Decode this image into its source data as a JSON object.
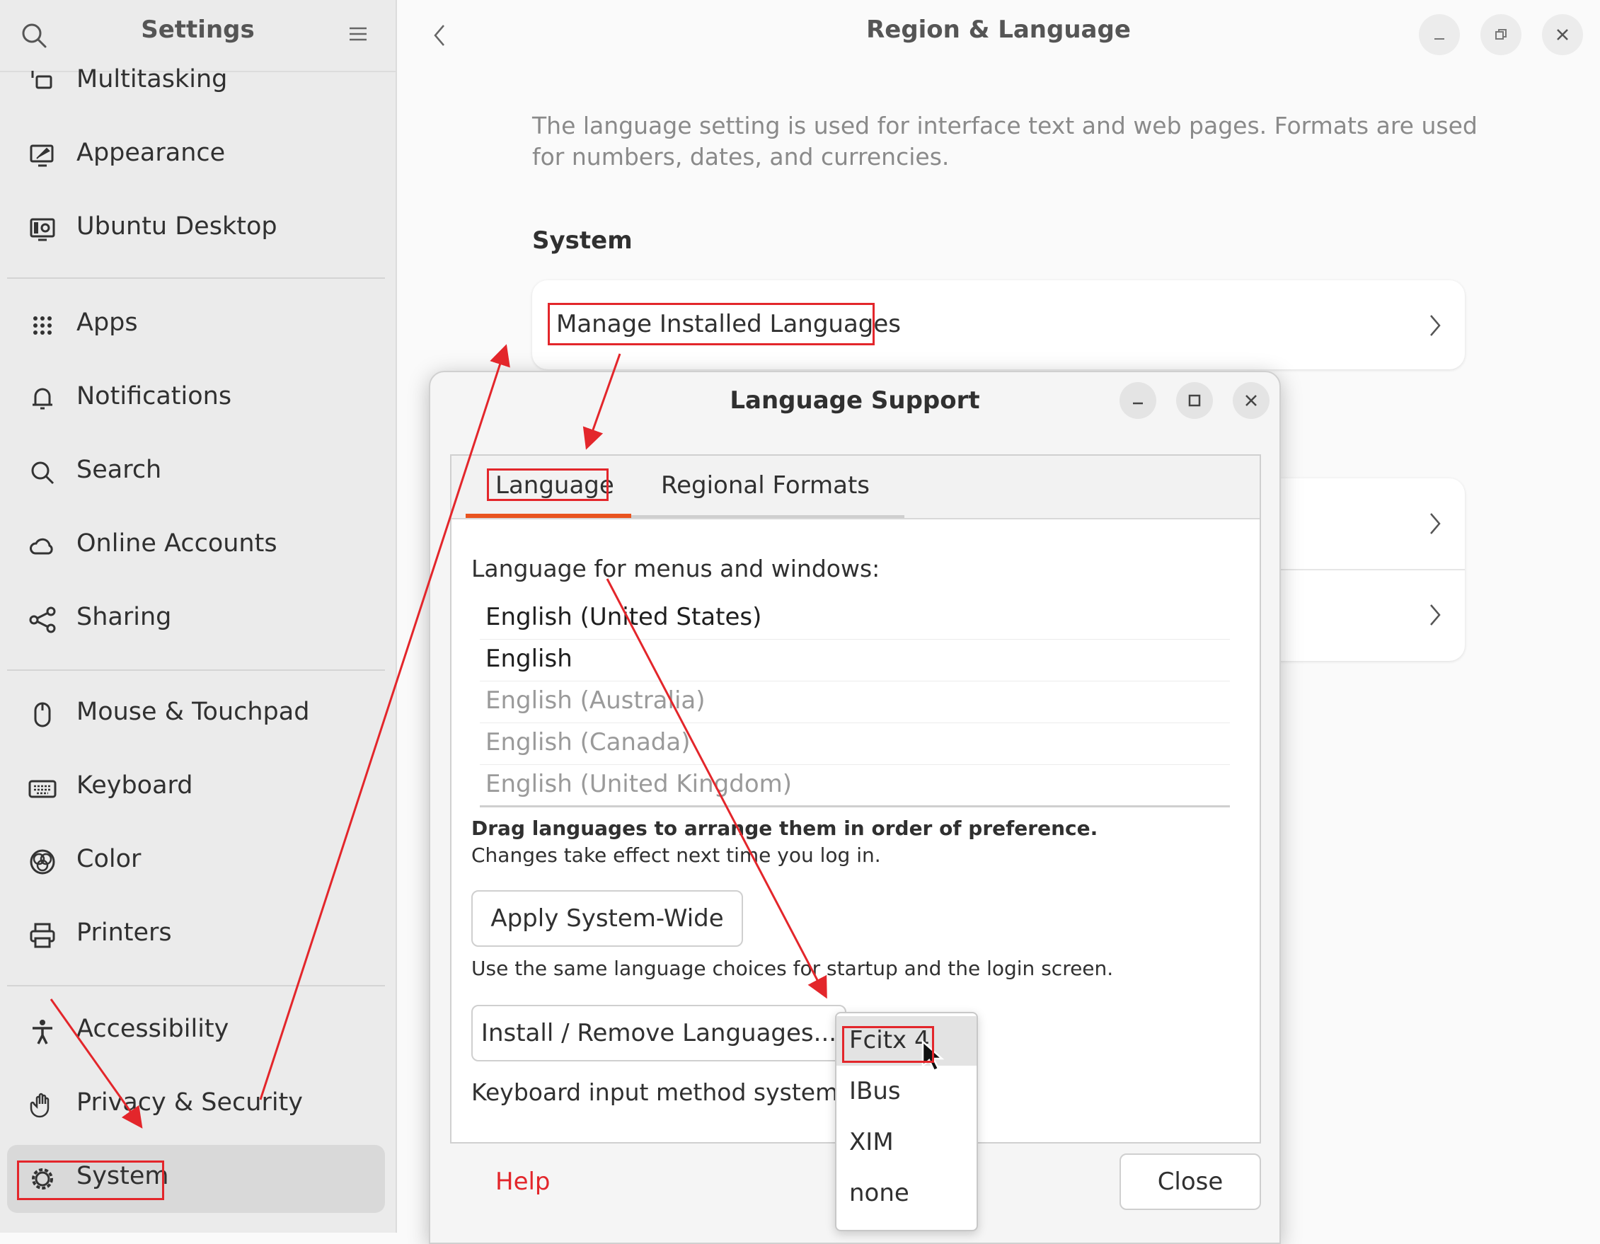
{
  "sidebar": {
    "title": "Settings",
    "items": [
      {
        "label": "Multitasking",
        "icon": "multitasking-icon"
      },
      {
        "label": "Appearance",
        "icon": "appearance-icon"
      },
      {
        "label": "Ubuntu Desktop",
        "icon": "ubuntu-desktop-icon"
      },
      {
        "label": "Apps",
        "icon": "apps-grid-icon"
      },
      {
        "label": "Notifications",
        "icon": "bell-icon"
      },
      {
        "label": "Search",
        "icon": "search-icon"
      },
      {
        "label": "Online Accounts",
        "icon": "cloud-icon"
      },
      {
        "label": "Sharing",
        "icon": "share-icon"
      },
      {
        "label": "Mouse & Touchpad",
        "icon": "mouse-icon"
      },
      {
        "label": "Keyboard",
        "icon": "keyboard-icon"
      },
      {
        "label": "Color",
        "icon": "color-icon"
      },
      {
        "label": "Printers",
        "icon": "printer-icon"
      },
      {
        "label": "Accessibility",
        "icon": "accessibility-icon"
      },
      {
        "label": "Privacy & Security",
        "icon": "hand-icon"
      },
      {
        "label": "System",
        "icon": "gear-icon"
      }
    ],
    "active_item": "System"
  },
  "main": {
    "title": "Region & Language",
    "description": "The language setting is used for interface text and web pages. Formats are used for numbers, dates, and currencies.",
    "section_title": "System",
    "manage_languages_label": "Manage Installed Languages"
  },
  "dialog": {
    "title": "Language Support",
    "tabs": [
      "Language",
      "Regional Formats"
    ],
    "active_tab": "Language",
    "menus_label": "Language for menus and windows:",
    "languages": [
      {
        "label": "English (United States)",
        "enabled": true
      },
      {
        "label": "English",
        "enabled": true
      },
      {
        "label": "English (Australia)",
        "enabled": false
      },
      {
        "label": "English (Canada)",
        "enabled": false
      },
      {
        "label": "English (United Kingdom)",
        "enabled": false
      }
    ],
    "drag_hint_bold": "Drag languages to arrange them in order of preference.",
    "drag_hint": "Changes take effect next time you log in.",
    "apply_button": "Apply System-Wide",
    "apply_hint": "Use the same language choices for startup and the login screen.",
    "install_button": "Install / Remove Languages...",
    "input_method_label": "Keyboard input method system:",
    "help_label": "Help",
    "close_button": "Close"
  },
  "input_method_popup": {
    "options": [
      "Fcitx 4",
      "IBus",
      "XIM",
      "none"
    ],
    "selected": "Fcitx 4"
  },
  "colors": {
    "annotation": "#e3262b",
    "accent": "#e95420"
  }
}
